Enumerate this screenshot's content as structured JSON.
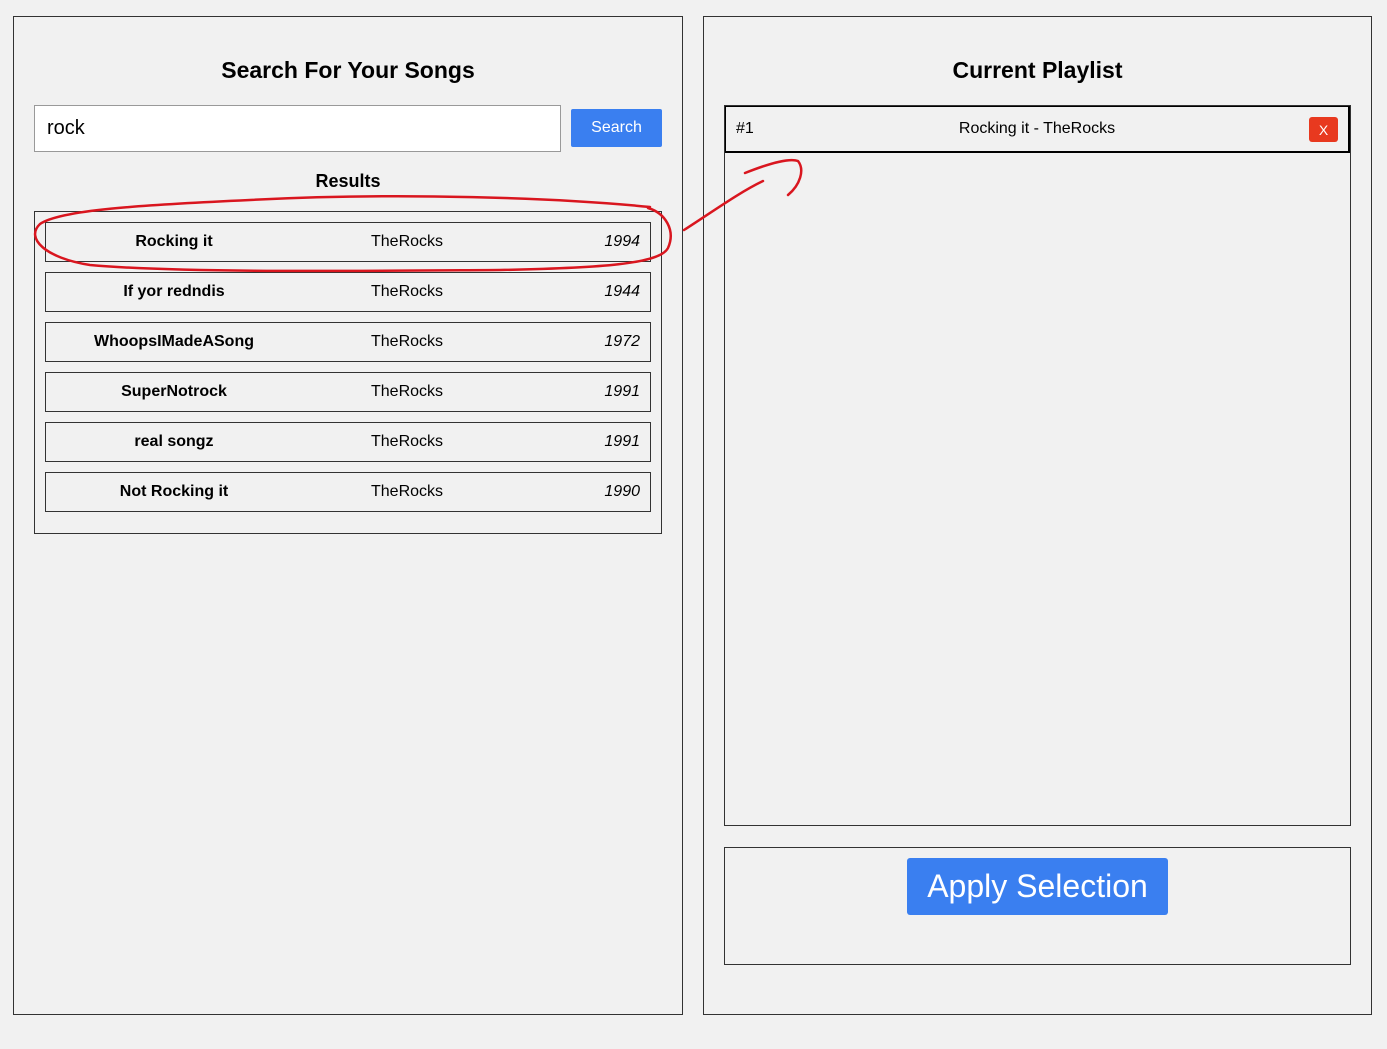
{
  "search_panel": {
    "title": "Search For Your Songs",
    "search_value": "rock",
    "search_button_label": "Search",
    "results_heading": "Results",
    "results": [
      {
        "song": "Rocking it",
        "artist": "TheRocks",
        "year": "1994"
      },
      {
        "song": "If yor redndis",
        "artist": "TheRocks",
        "year": "1944"
      },
      {
        "song": "WhoopsIMadeASong",
        "artist": "TheRocks",
        "year": "1972"
      },
      {
        "song": "SuperNotrock",
        "artist": "TheRocks",
        "year": "1991"
      },
      {
        "song": "real songz",
        "artist": "TheRocks",
        "year": "1991"
      },
      {
        "song": "Not Rocking it",
        "artist": "TheRocks",
        "year": "1990"
      }
    ]
  },
  "playlist_panel": {
    "title": "Current Playlist",
    "items": [
      {
        "position": "#1",
        "title": "Rocking it - TheRocks",
        "remove_label": "X"
      }
    ],
    "apply_button_label": "Apply Selection"
  },
  "colors": {
    "accent": "#3a7ff0",
    "remove": "#e8391f",
    "annotation": "#d9161f",
    "background": "#f1f1f1"
  }
}
